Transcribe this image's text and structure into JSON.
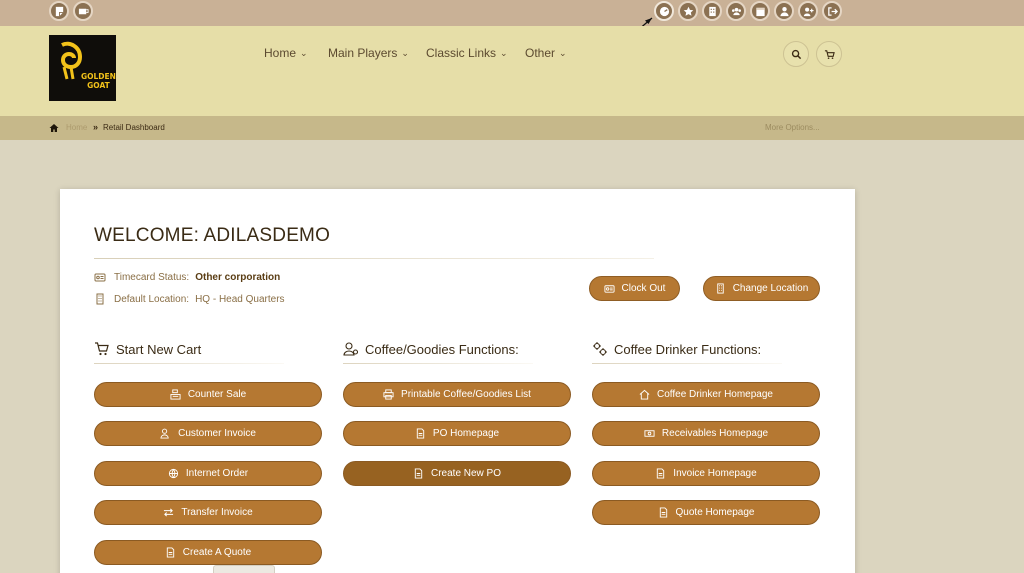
{
  "brand": {
    "name": "GOLDEN GOAT",
    "logo_line1": "GOLDEN",
    "logo_line2": "GOAT"
  },
  "topbar": {
    "left_icons": [
      "notes-icon",
      "coffee-icon"
    ],
    "right_icons": [
      "dashboard-icon",
      "star-icon",
      "building-icon",
      "users-icon",
      "calendar-icon",
      "user-icon",
      "add-user-icon",
      "logout-icon"
    ]
  },
  "nav": {
    "home": "Home",
    "main_players": "Main Players",
    "classic_links": "Classic Links",
    "other": "Other"
  },
  "breadcrumb": {
    "home": "Home",
    "separator": "»",
    "current": "Retail Dashboard",
    "more": "More Options..."
  },
  "welcome": {
    "title": "WELCOME: ADILASDEMO"
  },
  "status": {
    "timecard_label": "Timecard Status:",
    "timecard_value": "Other corporation",
    "location_label": "Default Location:",
    "location_value": "HQ - Head Quarters"
  },
  "actions": {
    "clock_out": "Clock Out",
    "change_location": "Change Location"
  },
  "sections": {
    "cart": {
      "title": "Start New Cart",
      "buttons": [
        "Counter Sale",
        "Customer Invoice",
        "Internet Order",
        "Transfer Invoice",
        "Create A Quote"
      ]
    },
    "coffee": {
      "title": "Coffee/Goodies Functions:",
      "buttons": [
        "Printable Coffee/Goodies List",
        "PO Homepage",
        "Create New PO"
      ]
    },
    "drinker": {
      "title": "Coffee Drinker Functions:",
      "buttons": [
        "Coffee Drinker Homepage",
        "Receivables Homepage",
        "Invoice Homepage",
        "Quote Homepage"
      ]
    }
  },
  "colors": {
    "button": "#b57832",
    "button_active": "#976221",
    "header": "#e6dea8",
    "topbar": "#c9b196",
    "breadcrumb": "#c6b88a",
    "page": "#dbd5bf"
  }
}
